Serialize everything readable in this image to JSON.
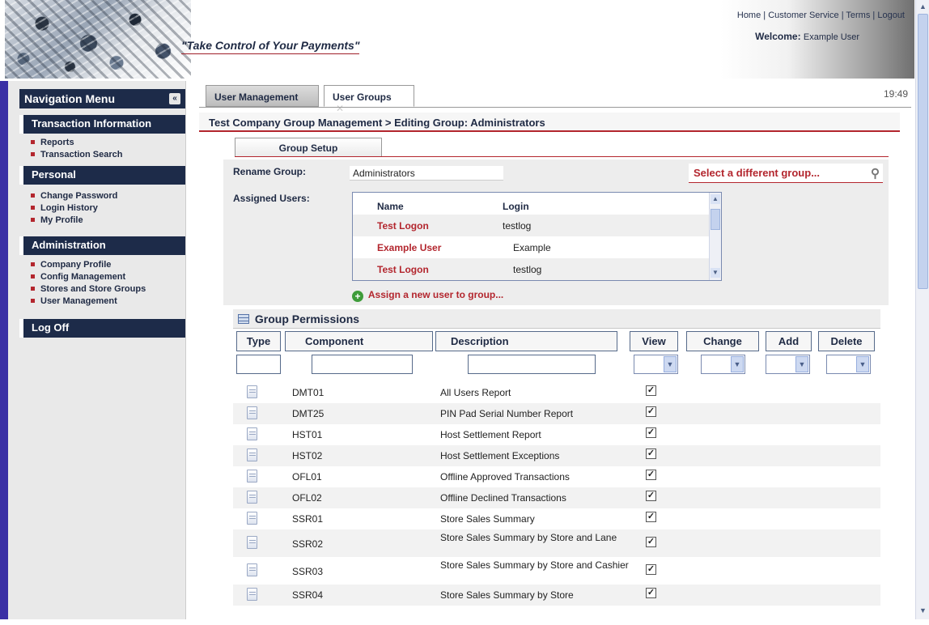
{
  "header": {
    "tagline": "\"Take Control of Your Payments\"",
    "links": [
      "Home",
      "Customer Service",
      "Terms",
      "Logout"
    ],
    "welcome_label": "Welcome:",
    "welcome_user": "Example User"
  },
  "nav": {
    "title": "Navigation Menu",
    "collapse_icon": "«",
    "sections": [
      {
        "label": "Transaction Information",
        "items": [
          "Reports",
          "Transaction Search"
        ]
      },
      {
        "label": "Personal",
        "items": [
          "Change Password",
          "Login History",
          "My Profile"
        ]
      },
      {
        "label": "Administration",
        "items": [
          "Company Profile",
          "Config Management",
          "Stores and Store Groups",
          "User Management"
        ]
      },
      {
        "label": "Log Off",
        "items": []
      }
    ]
  },
  "tabs": {
    "items": [
      {
        "label": "User Management",
        "active": false
      },
      {
        "label": "User Groups",
        "active": true,
        "close": "✕"
      }
    ],
    "clock": "19:49"
  },
  "breadcrumb": "Test Company Group Management > Editing Group: Administrators",
  "subtab": "Group Setup",
  "form": {
    "rename_label": "Rename Group:",
    "rename_value": "Administrators",
    "select_group": "Select a different group...",
    "assigned_label": "Assigned Users:",
    "users_header": {
      "name": "Name",
      "login": "Login"
    },
    "users": [
      {
        "name": "Test Logon",
        "login": "testlog"
      },
      {
        "name": "Example User",
        "login": "Example"
      },
      {
        "name": "Test Logon",
        "login": "testlog"
      }
    ],
    "assign_link": "Assign a new user to group..."
  },
  "permissions": {
    "title": "Group Permissions",
    "columns": [
      "Type",
      "Component",
      "Description",
      "View",
      "Change",
      "Add",
      "Delete"
    ],
    "rows": [
      {
        "component": "DMT01",
        "description": "All Users Report",
        "view": true
      },
      {
        "component": "DMT25",
        "description": "PIN Pad Serial Number Report",
        "view": true
      },
      {
        "component": "HST01",
        "description": "Host Settlement Report",
        "view": true
      },
      {
        "component": "HST02",
        "description": "Host Settlement Exceptions",
        "view": true
      },
      {
        "component": "OFL01",
        "description": "Offline Approved Transactions",
        "view": true
      },
      {
        "component": "OFL02",
        "description": "Offline Declined Transactions",
        "view": true
      },
      {
        "component": "SSR01",
        "description": "Store Sales Summary",
        "view": true
      },
      {
        "component": "SSR02",
        "description": "Store Sales Summary by Store and Lane",
        "view": true
      },
      {
        "component": "SSR03",
        "description": "Store Sales Summary by Store and Cashier",
        "view": true
      },
      {
        "component": "SSR04",
        "description": "Store Sales Summary by Store",
        "view": true
      }
    ]
  },
  "colors": {
    "accent_red": "#b3262e",
    "nav_navy": "#1d2b49"
  }
}
